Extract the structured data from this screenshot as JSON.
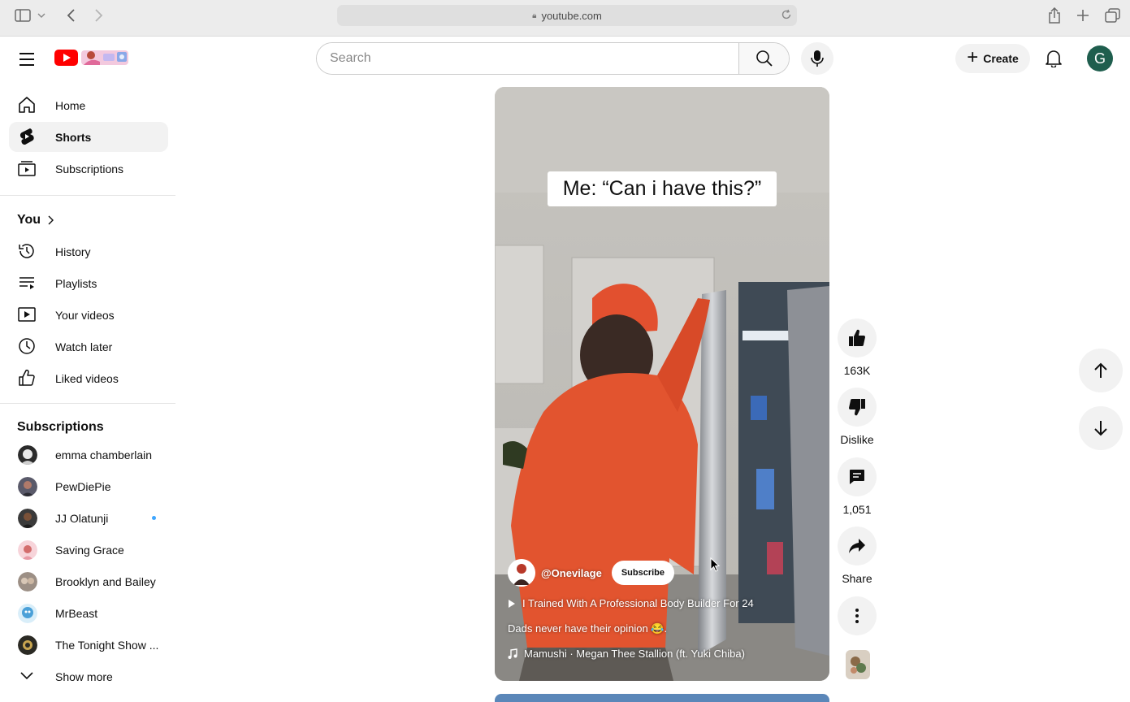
{
  "browser": {
    "url": "youtube.com"
  },
  "header": {
    "search_placeholder": "Search",
    "create_label": "Create",
    "avatar_letter": "G"
  },
  "sidebar": {
    "primary": [
      {
        "label": "Home",
        "icon": "home-icon"
      },
      {
        "label": "Shorts",
        "icon": "shorts-icon",
        "active": true
      },
      {
        "label": "Subscriptions",
        "icon": "subscriptions-icon"
      }
    ],
    "you_title": "You",
    "you_items": [
      {
        "label": "History",
        "icon": "history-icon"
      },
      {
        "label": "Playlists",
        "icon": "playlists-icon"
      },
      {
        "label": "Your videos",
        "icon": "your-videos-icon"
      },
      {
        "label": "Watch later",
        "icon": "watch-later-icon"
      },
      {
        "label": "Liked videos",
        "icon": "liked-videos-icon"
      }
    ],
    "subs_title": "Subscriptions",
    "subscriptions": [
      {
        "label": "emma chamberlain",
        "color": "#d9d9d9"
      },
      {
        "label": "PewDiePie",
        "color": "#5a5a6a"
      },
      {
        "label": "JJ Olatunji",
        "color": "#3a3a3a",
        "new": true
      },
      {
        "label": "Saving Grace",
        "color": "#f2b6c0"
      },
      {
        "label": "Brooklyn and Bailey",
        "color": "#9c8f85"
      },
      {
        "label": "MrBeast",
        "color": "#4aa0d8"
      },
      {
        "label": "The Tonight Show ...",
        "color": "#2b2a24"
      }
    ],
    "show_more": "Show more"
  },
  "short": {
    "caption": "Me: “Can i have this?”",
    "channel": "@Onevilage",
    "subscribe_label": "Subscribe",
    "related": "I Trained With A Professional Body Builder For 24",
    "description": "Dads never have their opinion 😂.",
    "music": "Mamushi · Megan Thee Stallion (ft. Yuki Chiba)"
  },
  "actions": {
    "likes": "163K",
    "dislike_label": "Dislike",
    "comments": "1,051",
    "share_label": "Share"
  }
}
